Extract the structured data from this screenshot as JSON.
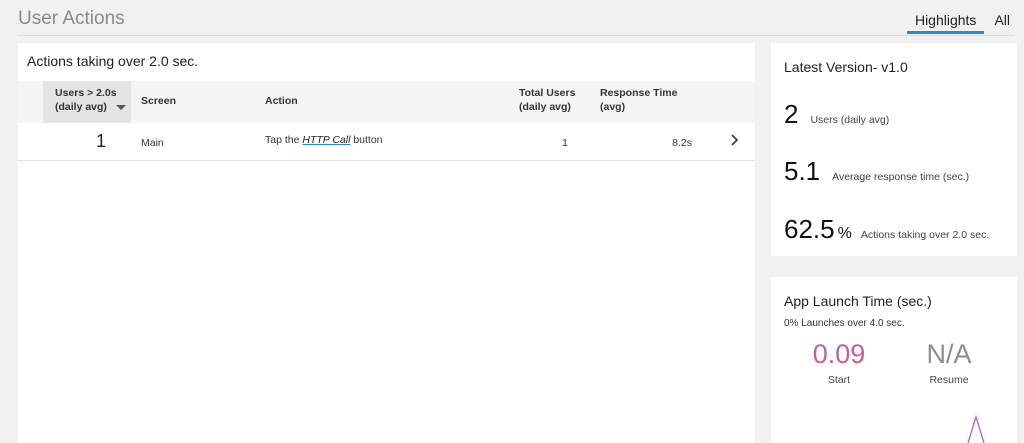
{
  "header": {
    "title": "User Actions",
    "tabs": [
      {
        "label": "Highlights",
        "active": true
      },
      {
        "label": "All",
        "active": false
      }
    ],
    "accent_color": "#1e8fd6"
  },
  "actions_card": {
    "heading": "Actions taking over 2.0 sec.",
    "columns": {
      "users_line1": "Users > 2.0s",
      "users_line2": "(daily avg)",
      "screen": "Screen",
      "action": "Action",
      "total_line1": "Total Users",
      "total_line2": "(daily avg)",
      "response_line1": "Response Time",
      "response_line2": "(avg)"
    },
    "sort_icon": "caret-down-icon",
    "rows": [
      {
        "users": "1",
        "screen": "Main",
        "action_prefix": "Tap the ",
        "action_link": "HTTP Call",
        "action_suffix": " button",
        "total_users": "1",
        "response_time": "8.2s"
      }
    ],
    "row_icon": "chevron-right-icon"
  },
  "version_card": {
    "title": "Latest Version- v1.0",
    "stats": [
      {
        "value": "2",
        "unit": "",
        "label": "Users (daily avg)"
      },
      {
        "value": "5.1",
        "unit": "",
        "label": "Average response time (sec.)"
      },
      {
        "value": "62.5",
        "unit": "%",
        "label": "Actions taking over 2.0 sec."
      }
    ]
  },
  "launch_card": {
    "title": "App Launch Time (sec.)",
    "subtitle": "0% Launches over 4.0 sec.",
    "start": {
      "value": "0.09",
      "label": "Start",
      "color": "#c2609a"
    },
    "resume": {
      "value": "N/A",
      "label": "Resume",
      "color": "#8d8d8d"
    }
  }
}
